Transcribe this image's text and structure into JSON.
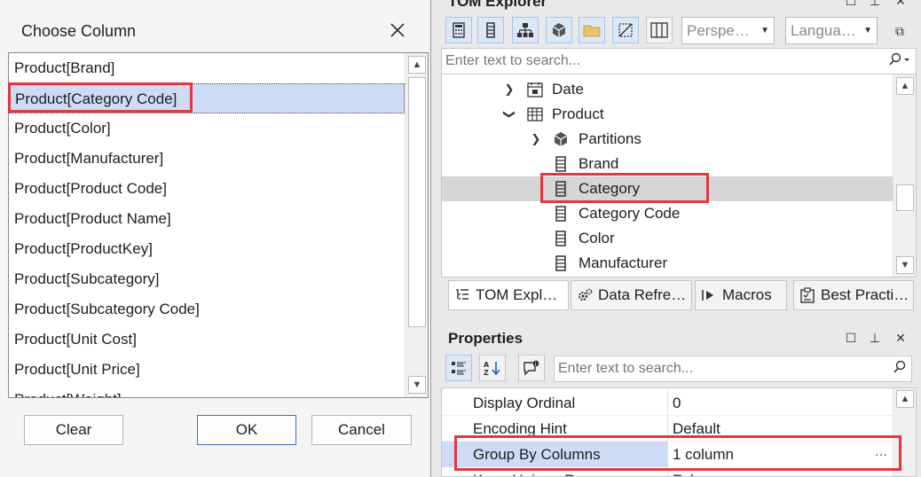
{
  "dialog": {
    "title": "Choose Column",
    "columns": [
      "Product[Brand]",
      "Product[Category Code]",
      "Product[Color]",
      "Product[Manufacturer]",
      "Product[Product Code]",
      "Product[Product Name]",
      "Product[ProductKey]",
      "Product[Subcategory]",
      "Product[Subcategory Code]",
      "Product[Unit Cost]",
      "Product[Unit Price]",
      "Product[Weight]"
    ],
    "selected_column": "Product[Category Code]",
    "buttons": {
      "clear": "Clear",
      "ok": "OK",
      "cancel": "Cancel"
    }
  },
  "tom_explorer": {
    "title": "TOM Explorer",
    "perspective_placeholder": "Perspe…",
    "language_placeholder": "Langua…",
    "search_placeholder": "Enter text to search...",
    "tree": [
      {
        "label": "Date",
        "icon": "calendar-table-icon",
        "expander": "collapsed"
      },
      {
        "label": "Product",
        "icon": "table-icon",
        "expander": "expanded"
      },
      {
        "label": "Partitions",
        "icon": "partitions-cube-icon",
        "expander": "collapsed"
      },
      {
        "label": "Brand",
        "icon": "column-icon"
      },
      {
        "label": "Category",
        "icon": "column-icon",
        "selected": true
      },
      {
        "label": "Category Code",
        "icon": "column-icon"
      },
      {
        "label": "Color",
        "icon": "column-icon"
      },
      {
        "label": "Manufacturer",
        "icon": "column-icon"
      }
    ],
    "tabs": [
      {
        "label": "TOM Expl…",
        "icon": "tree-icon",
        "active": true
      },
      {
        "label": "Data Refre…",
        "icon": "gears-icon"
      },
      {
        "label": "Macros",
        "icon": "macro-play-icon"
      },
      {
        "label": "Best Practi…",
        "icon": "clipboard-icon"
      }
    ]
  },
  "properties": {
    "title": "Properties",
    "search_placeholder": "Enter text to search...",
    "rows": [
      {
        "name": "Display Ordinal",
        "value": "0"
      },
      {
        "name": "Encoding Hint",
        "value": "Default"
      },
      {
        "name": "Group By Columns",
        "value": "1 column",
        "selected": true,
        "ellipsis": "···"
      },
      {
        "name": "Keep Unique Rows",
        "value": "False"
      }
    ]
  },
  "colors": {
    "highlight_box": "#e8353e",
    "selection": "#cddcf4",
    "tree_selection": "#d6d6d6",
    "toolbar_active": "#dde8f7"
  }
}
